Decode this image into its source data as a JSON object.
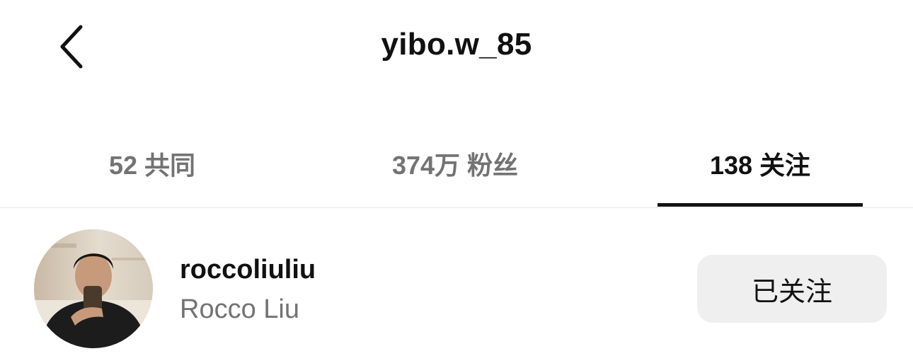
{
  "header": {
    "title": "yibo.w_85",
    "back_icon": "chevron-left-icon"
  },
  "tabs": [
    {
      "label": "52 共同",
      "active": false
    },
    {
      "label": "374万 粉丝",
      "active": false
    },
    {
      "label": "138 关注",
      "active": true
    }
  ],
  "users": [
    {
      "username": "roccoliuliu",
      "full_name": "Rocco Liu",
      "button_label": "已关注"
    }
  ],
  "colors": {
    "primary_text": "#111111",
    "secondary_text": "#737373",
    "button_bg": "#efefef",
    "divider": "#e6e6e6"
  }
}
